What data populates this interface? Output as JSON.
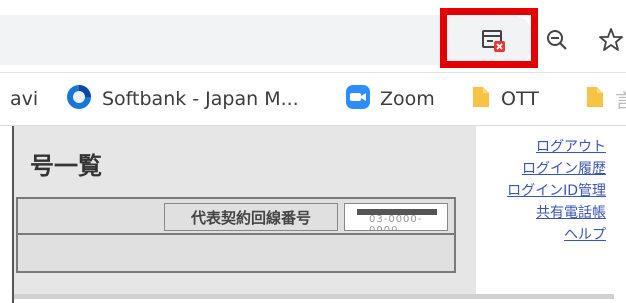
{
  "bookmarks": [
    {
      "label": "avi",
      "icon": "folder-icon"
    },
    {
      "label": "Softbank - Japan M...",
      "icon": "softbank-icon"
    },
    {
      "label": "Zoom",
      "icon": "zoom-video-icon"
    },
    {
      "label": "OTT",
      "icon": "folder-icon"
    },
    {
      "label": "言",
      "icon": "folder-icon"
    }
  ],
  "page": {
    "title": "号一覧",
    "table_header": "代表契約回線番号",
    "table_value": "03-0000-0000"
  },
  "links": [
    "ログアウト",
    "ログイン履歴",
    "ログインID管理",
    "共有電話帳",
    "ヘルプ"
  ],
  "colors": {
    "highlight": "#e60000",
    "link": "#3a55b5",
    "zoom_blue": "#2d8cff",
    "softbank_blue": "#1976d2",
    "folder_yellow": "#f6c344"
  }
}
